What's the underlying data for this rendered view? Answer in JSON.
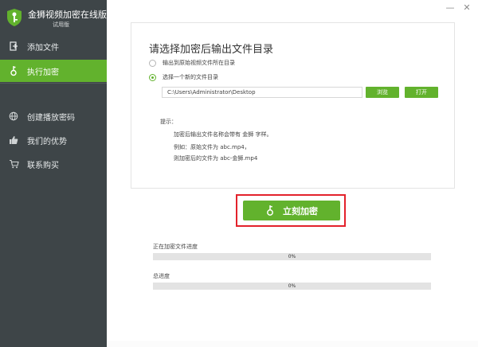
{
  "app": {
    "title": "金狮视频加密在线版",
    "subtitle": "试用版",
    "window_controls": {
      "minimize": "—",
      "close": "✕"
    }
  },
  "sidebar": {
    "items": [
      {
        "label": "添加文件",
        "icon": "add-file-icon",
        "active": false
      },
      {
        "label": "执行加密",
        "icon": "encrypt-key-icon",
        "active": true
      },
      {
        "label": "创建播放密码",
        "icon": "globe-icon",
        "active": false
      },
      {
        "label": "我们的优势",
        "icon": "thumbs-up-icon",
        "active": false
      },
      {
        "label": "联系购买",
        "icon": "cart-icon",
        "active": false
      }
    ]
  },
  "output": {
    "title": "请选择加密后输出文件目录",
    "options": [
      {
        "label": "输出到原始视频文件所在目录",
        "checked": false
      },
      {
        "label": "选择一个新的文件目录",
        "checked": true
      }
    ],
    "path_value": "C:\\Users\\Administrator\\Desktop",
    "browse_label": "浏览",
    "open_label": "打开"
  },
  "tips": {
    "label": "提示：",
    "lines": [
      "加密后输出文件名称会带有 金狮 字样。",
      "例如：原始文件为 abc.mp4，",
      "则加密后的文件为 abc-金狮.mp4"
    ]
  },
  "encrypt_button": {
    "label": "立刻加密"
  },
  "progress": {
    "current": {
      "label": "正在加密文件进度",
      "value": 0,
      "text": "0%"
    },
    "total": {
      "label": "总进度",
      "value": 0,
      "text": "0%"
    }
  },
  "colors": {
    "accent": "#62b22d",
    "sidebar_bg": "#3e4548",
    "highlight_frame": "#e3222b"
  }
}
